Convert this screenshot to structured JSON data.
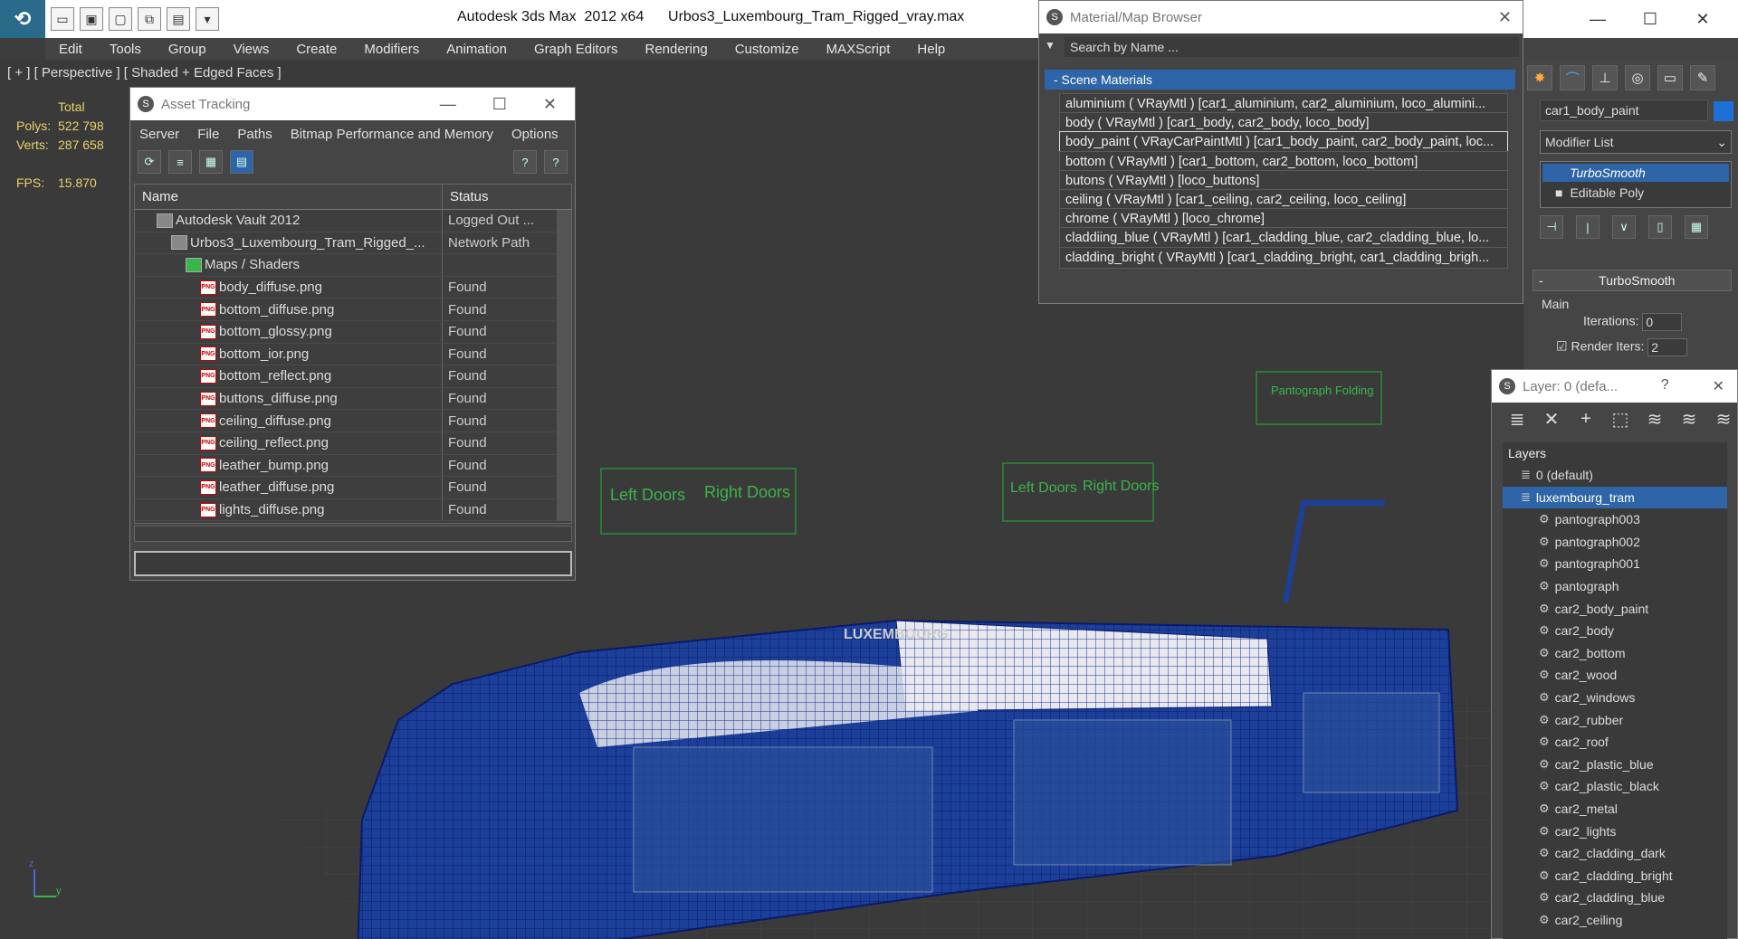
{
  "titlebar": {
    "logo": "⟲",
    "title": "Autodesk 3ds Max  2012 x64      Urbos3_Luxembourg_Tram_Rigged_vray.max",
    "qa_icons": [
      "open-icon",
      "save-icon",
      "new-icon",
      "hold-icon",
      "fetch-icon",
      "dropdown-icon"
    ],
    "win_minimize": "—",
    "win_maximize": "☐",
    "win_close": "✕"
  },
  "menu": [
    "Edit",
    "Tools",
    "Group",
    "Views",
    "Create",
    "Modifiers",
    "Animation",
    "Graph Editors",
    "Rendering",
    "Customize",
    "MAXScript",
    "Help"
  ],
  "viewport": {
    "label": "[ + ] [ Perspective ] [ Shaded + Edged Faces ]",
    "stats": {
      "total_label": "Total",
      "polys_label": "Polys:",
      "polys": "522 798",
      "verts_label": "Verts:",
      "verts": "287 658",
      "fps_label": "FPS:",
      "fps": "15.870"
    },
    "scene_labels": {
      "left_doors_1": "Left Doors",
      "right_doors_1": "Right Doors",
      "left_doors_2": "Left Doors",
      "right_doors_2": "Right Doors",
      "pantograph": "Pantograph Folding",
      "tram_name": "LUXEMBOURG"
    }
  },
  "asset_tracking": {
    "title": "Asset Tracking",
    "menu": [
      "Server",
      "File",
      "Paths",
      "Bitmap Performance and Memory",
      "Options"
    ],
    "columns": [
      "Name",
      "Status"
    ],
    "rows": [
      {
        "name": "Autodesk Vault 2012",
        "status": "Logged Out ..."
      },
      {
        "name": "Urbos3_Luxembourg_Tram_Rigged_...",
        "status": "Network Path"
      },
      {
        "name": "Maps / Shaders",
        "status": ""
      },
      {
        "name": "body_diffuse.png",
        "status": "Found"
      },
      {
        "name": "bottom_diffuse.png",
        "status": "Found"
      },
      {
        "name": "bottom_glossy.png",
        "status": "Found"
      },
      {
        "name": "bottom_ior.png",
        "status": "Found"
      },
      {
        "name": "bottom_reflect.png",
        "status": "Found"
      },
      {
        "name": "buttons_diffuse.png",
        "status": "Found"
      },
      {
        "name": "ceiling_diffuse.png",
        "status": "Found"
      },
      {
        "name": "ceiling_reflect.png",
        "status": "Found"
      },
      {
        "name": "leather_bump.png",
        "status": "Found"
      },
      {
        "name": "leather_diffuse.png",
        "status": "Found"
      },
      {
        "name": "lights_diffuse.png",
        "status": "Found"
      }
    ],
    "png_badge": "PNG"
  },
  "material_browser": {
    "title": "Material/Map Browser",
    "search_placeholder": "Search by Name ...",
    "section": "- Scene Materials",
    "materials": [
      "aluminium  ( VRayMtl )  [car1_aluminium, car2_aluminium, loco_alumini...",
      "body  ( VRayMtl )  [car1_body, car2_body, loco_body]",
      "body_paint  ( VRayCarPaintMtl ) [car1_body_paint, car2_body_paint, loc...",
      "bottom  ( VRayMtl )  [car1_bottom, car2_bottom, loco_bottom]",
      "butons  ( VRayMtl )  [loco_buttons]",
      "ceiling  ( VRayMtl )  [car1_ceiling, car2_ceiling, loco_ceiling]",
      "chrome  ( VRayMtl )  [loco_chrome]",
      "claddiing_blue  ( VRayMtl ) [car1_cladding_blue, car2_cladding_blue, lo...",
      "cladding_bright  ( VRayMtl ) [car1_cladding_bright, car1_cladding_brigh..."
    ],
    "selected_index": 2
  },
  "command_panel": {
    "object_name": "car1_body_paint",
    "object_color": "#1e6fd6",
    "modifier_list": "Modifier List",
    "stack": [
      "TurboSmooth",
      "Editable Poly"
    ],
    "rollout": "TurboSmooth",
    "group": "Main",
    "iterations_label": "Iterations:",
    "iterations": "0",
    "render_iters_label": "Render Iters:",
    "render_iters": "2"
  },
  "layer_window": {
    "title": "Layer: 0 (defa...",
    "help": "?",
    "close": "✕",
    "header": "Layers",
    "layers": [
      {
        "name": "0 (default)",
        "level": 0
      },
      {
        "name": "luxembourg_tram",
        "level": 0,
        "selected": true
      },
      {
        "name": "pantograph003",
        "level": 1
      },
      {
        "name": "pantograph002",
        "level": 1
      },
      {
        "name": "pantograph001",
        "level": 1
      },
      {
        "name": "pantograph",
        "level": 1
      },
      {
        "name": "car2_body_paint",
        "level": 1
      },
      {
        "name": "car2_body",
        "level": 1
      },
      {
        "name": "car2_bottom",
        "level": 1
      },
      {
        "name": "car2_wood",
        "level": 1
      },
      {
        "name": "car2_windows",
        "level": 1
      },
      {
        "name": "car2_rubber",
        "level": 1
      },
      {
        "name": "car2_roof",
        "level": 1
      },
      {
        "name": "car2_plastic_blue",
        "level": 1
      },
      {
        "name": "car2_plastic_black",
        "level": 1
      },
      {
        "name": "car2_metal",
        "level": 1
      },
      {
        "name": "car2_lights",
        "level": 1
      },
      {
        "name": "car2_cladding_dark",
        "level": 1
      },
      {
        "name": "car2_cladding_bright",
        "level": 1
      },
      {
        "name": "car2_cladding_blue",
        "level": 1
      },
      {
        "name": "car2_ceiling",
        "level": 1
      }
    ]
  }
}
